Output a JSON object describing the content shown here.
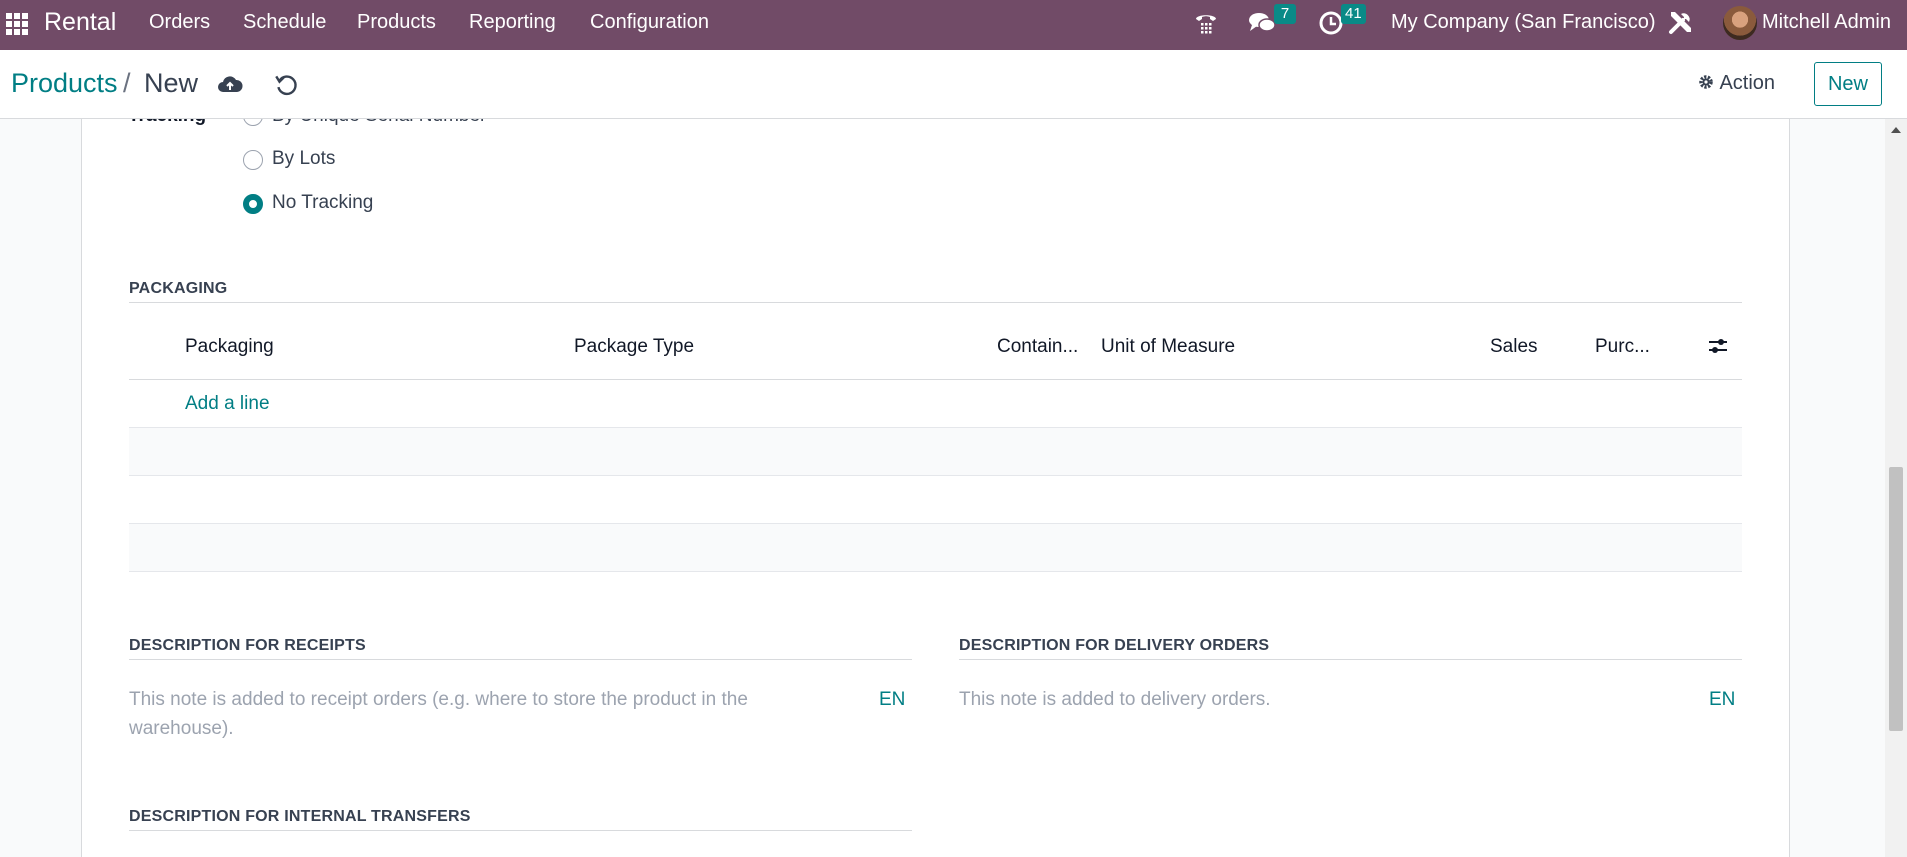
{
  "navbar": {
    "app_name": "Rental",
    "menu": [
      "Orders",
      "Schedule",
      "Products",
      "Reporting",
      "Configuration"
    ],
    "messages_count": "7",
    "activities_count": "41",
    "company": "My Company (San Francisco)",
    "user": "Mitchell Admin",
    "bar_color": "#714b67"
  },
  "breadcrumb": {
    "parent": "Products",
    "separator": "/",
    "current": "New"
  },
  "control_panel": {
    "action_label": "Action",
    "new_label": "New"
  },
  "tracking": {
    "label": "Tracking",
    "options": [
      "By Unique Serial Number",
      "By Lots",
      "No Tracking"
    ],
    "selected": "No Tracking"
  },
  "packaging": {
    "section_title": "PACKAGING",
    "columns": [
      "Packaging",
      "Package Type",
      "Contain...",
      "Unit of Measure",
      "Sales",
      "Purc..."
    ],
    "add_line": "Add a line"
  },
  "descriptions": {
    "receipts": {
      "title": "DESCRIPTION FOR RECEIPTS",
      "placeholder": "This note is added to receipt orders (e.g. where to store the product in the warehouse).",
      "lang": "EN"
    },
    "delivery": {
      "title": "DESCRIPTION FOR DELIVERY ORDERS",
      "placeholder": "This note is added to delivery orders.",
      "lang": "EN"
    },
    "internal": {
      "title": "DESCRIPTION FOR INTERNAL TRANSFERS"
    }
  },
  "colors": {
    "accent": "#017e84",
    "badge": "#0a8a87"
  }
}
